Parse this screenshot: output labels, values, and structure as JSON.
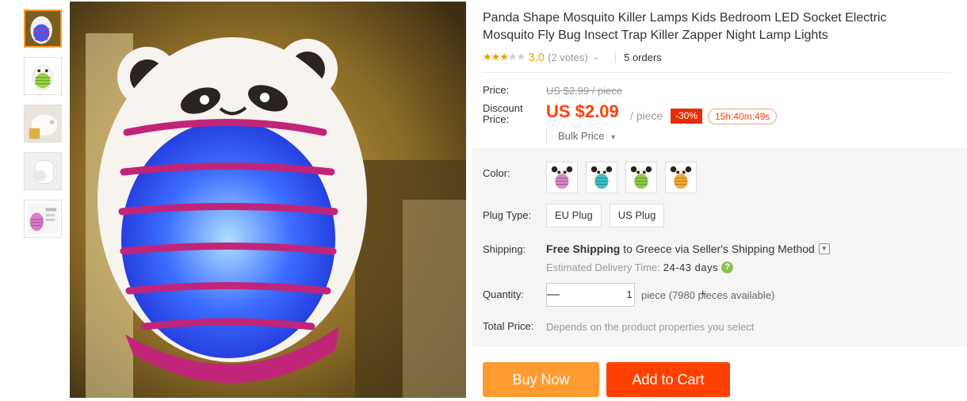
{
  "product": {
    "title": "Panda Shape Mosquito Killer Lamps Kids Bedroom LED Socket Electric Mosquito Fly Bug Insect Trap Killer Zapper Night Lamp Lights",
    "rating": {
      "stars_filled": 3,
      "stars_total": 5,
      "value": "3.0",
      "votes": "(2 votes)",
      "chevron_icon": "chevron-down-icon"
    },
    "orders": "5 orders"
  },
  "gallery": {
    "thumbnails_count": 5,
    "active_index": 0
  },
  "price": {
    "label": "Price:",
    "original": "US $2.99 / piece",
    "discount_label": "Discount Price:",
    "current": "US $2.09",
    "unit": "/ piece",
    "discount": "-30%",
    "countdown": "15h:40m:49s",
    "bulk": "Bulk Price"
  },
  "options": {
    "color_label": "Color:",
    "colors": [
      "#d18ec4",
      "#3fbfc6",
      "#8cc84b",
      "#f0a93a"
    ],
    "plug_label": "Plug Type:",
    "plugs": [
      "EU Plug",
      "US Plug"
    ]
  },
  "shipping": {
    "label": "Shipping:",
    "free": "Free Shipping",
    "to": " to ",
    "country": "Greece",
    "via": " via Seller's Shipping Method",
    "estimate_label": "Estimated Delivery Time:",
    "estimate_days": "24-43 days"
  },
  "quantity": {
    "label": "Quantity:",
    "value": "1",
    "minus": "—",
    "plus": "+",
    "available": "piece (7980 pieces available)"
  },
  "total": {
    "label": "Total Price:",
    "text": "Depends on the product properties you select"
  },
  "actions": {
    "buy_now": "Buy Now",
    "add_to_cart": "Add to Cart"
  },
  "theme": {
    "accent": "#ff4000",
    "buy_color": "#ff9b2f",
    "star_color": "#f2a006"
  }
}
